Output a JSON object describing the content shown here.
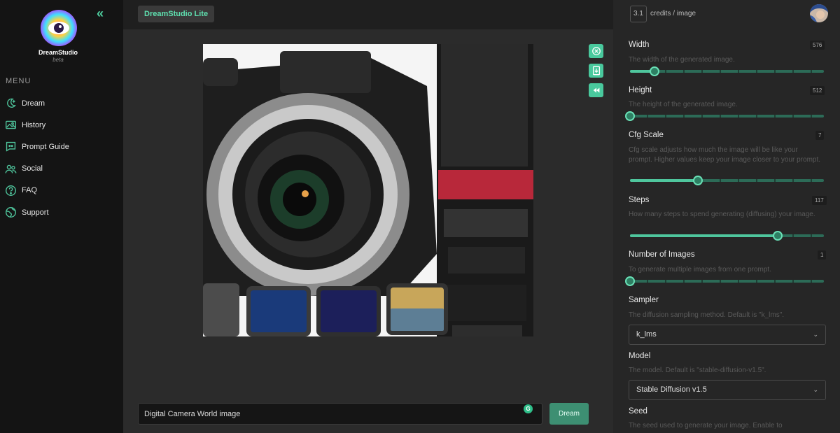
{
  "sidebar": {
    "brand": "DreamStudio",
    "beta": "beta",
    "menu_label": "MENU",
    "items": [
      {
        "label": "Dream",
        "icon": "dream-icon"
      },
      {
        "label": "History",
        "icon": "history-icon"
      },
      {
        "label": "Prompt Guide",
        "icon": "prompt-guide-icon"
      },
      {
        "label": "Social",
        "icon": "social-icon"
      },
      {
        "label": "FAQ",
        "icon": "faq-icon"
      },
      {
        "label": "Support",
        "icon": "support-icon"
      }
    ]
  },
  "topbar": {
    "collapse_icon": "double-chevron-left-icon",
    "tab_label": "DreamStudio Lite"
  },
  "canvas": {
    "tools": [
      "close-circle-icon",
      "download-icon",
      "rewind-icon"
    ],
    "prompt_value": "Digital Camera World image",
    "dream_label": "Dream"
  },
  "panel": {
    "credits_value": "3.1",
    "credits_label": "credits / image",
    "settings": [
      {
        "title": "Width",
        "value": "576",
        "desc": "The width of the generated image.",
        "fraction": 0.125
      },
      {
        "title": "Height",
        "value": "512",
        "desc": "The height of the generated image.",
        "fraction": 0.0
      },
      {
        "title": "Cfg Scale",
        "value": "7",
        "desc": "Cfg scale adjusts how much the image will be like your prompt. Higher values keep your image closer to your prompt.",
        "fraction": 0.35
      },
      {
        "title": "Steps",
        "value": "117",
        "desc": "How many steps to spend generating (diffusing) your image.",
        "fraction": 0.76
      },
      {
        "title": "Number of Images",
        "value": "1",
        "desc": "To generate multiple images from one prompt.",
        "fraction": 0.0
      }
    ],
    "sampler": {
      "title": "Sampler",
      "desc": "The diffusion sampling method. Default is \"k_lms\".",
      "value": "k_lms"
    },
    "model": {
      "title": "Model",
      "desc": "The model. Default is \"stable-diffusion-v1.5\".",
      "value": "Stable Diffusion v1.5"
    },
    "seed": {
      "title": "Seed",
      "desc": "The seed used to generate your image. Enable to"
    }
  },
  "colors": {
    "accent": "#4fc69d",
    "accent_dark": "#2e7f63",
    "sidebar_bg": "#141414",
    "panel_bg": "#262626"
  }
}
